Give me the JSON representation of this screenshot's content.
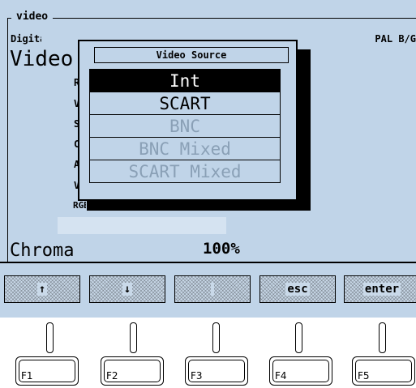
{
  "panel": {
    "title": "video",
    "header_left": "Digital So",
    "header_right": "PAL B/G",
    "mode_label": "Video",
    "row_letters": [
      "R",
      "V",
      "S",
      "C",
      "A",
      "V"
    ],
    "rgb_label": "RGB",
    "chroma_label": "Chroma",
    "chroma_value": "100%"
  },
  "popup": {
    "title": "Video Source",
    "options": [
      {
        "label": "Int",
        "state": "selected"
      },
      {
        "label": "SCART",
        "state": "enabled"
      },
      {
        "label": "BNC",
        "state": "disabled"
      },
      {
        "label": "BNC Mixed",
        "state": "disabled"
      },
      {
        "label": "SCART Mixed",
        "state": "disabled"
      }
    ]
  },
  "softkeys": [
    "↑",
    "↓",
    "",
    "esc",
    "enter"
  ],
  "function_keys": [
    "F1",
    "F2",
    "F3",
    "F4",
    "F5"
  ],
  "colors": {
    "screen_bg": "#c0d4e8",
    "selected_bg": "#000000",
    "disabled_text": "#8aa0b6"
  }
}
